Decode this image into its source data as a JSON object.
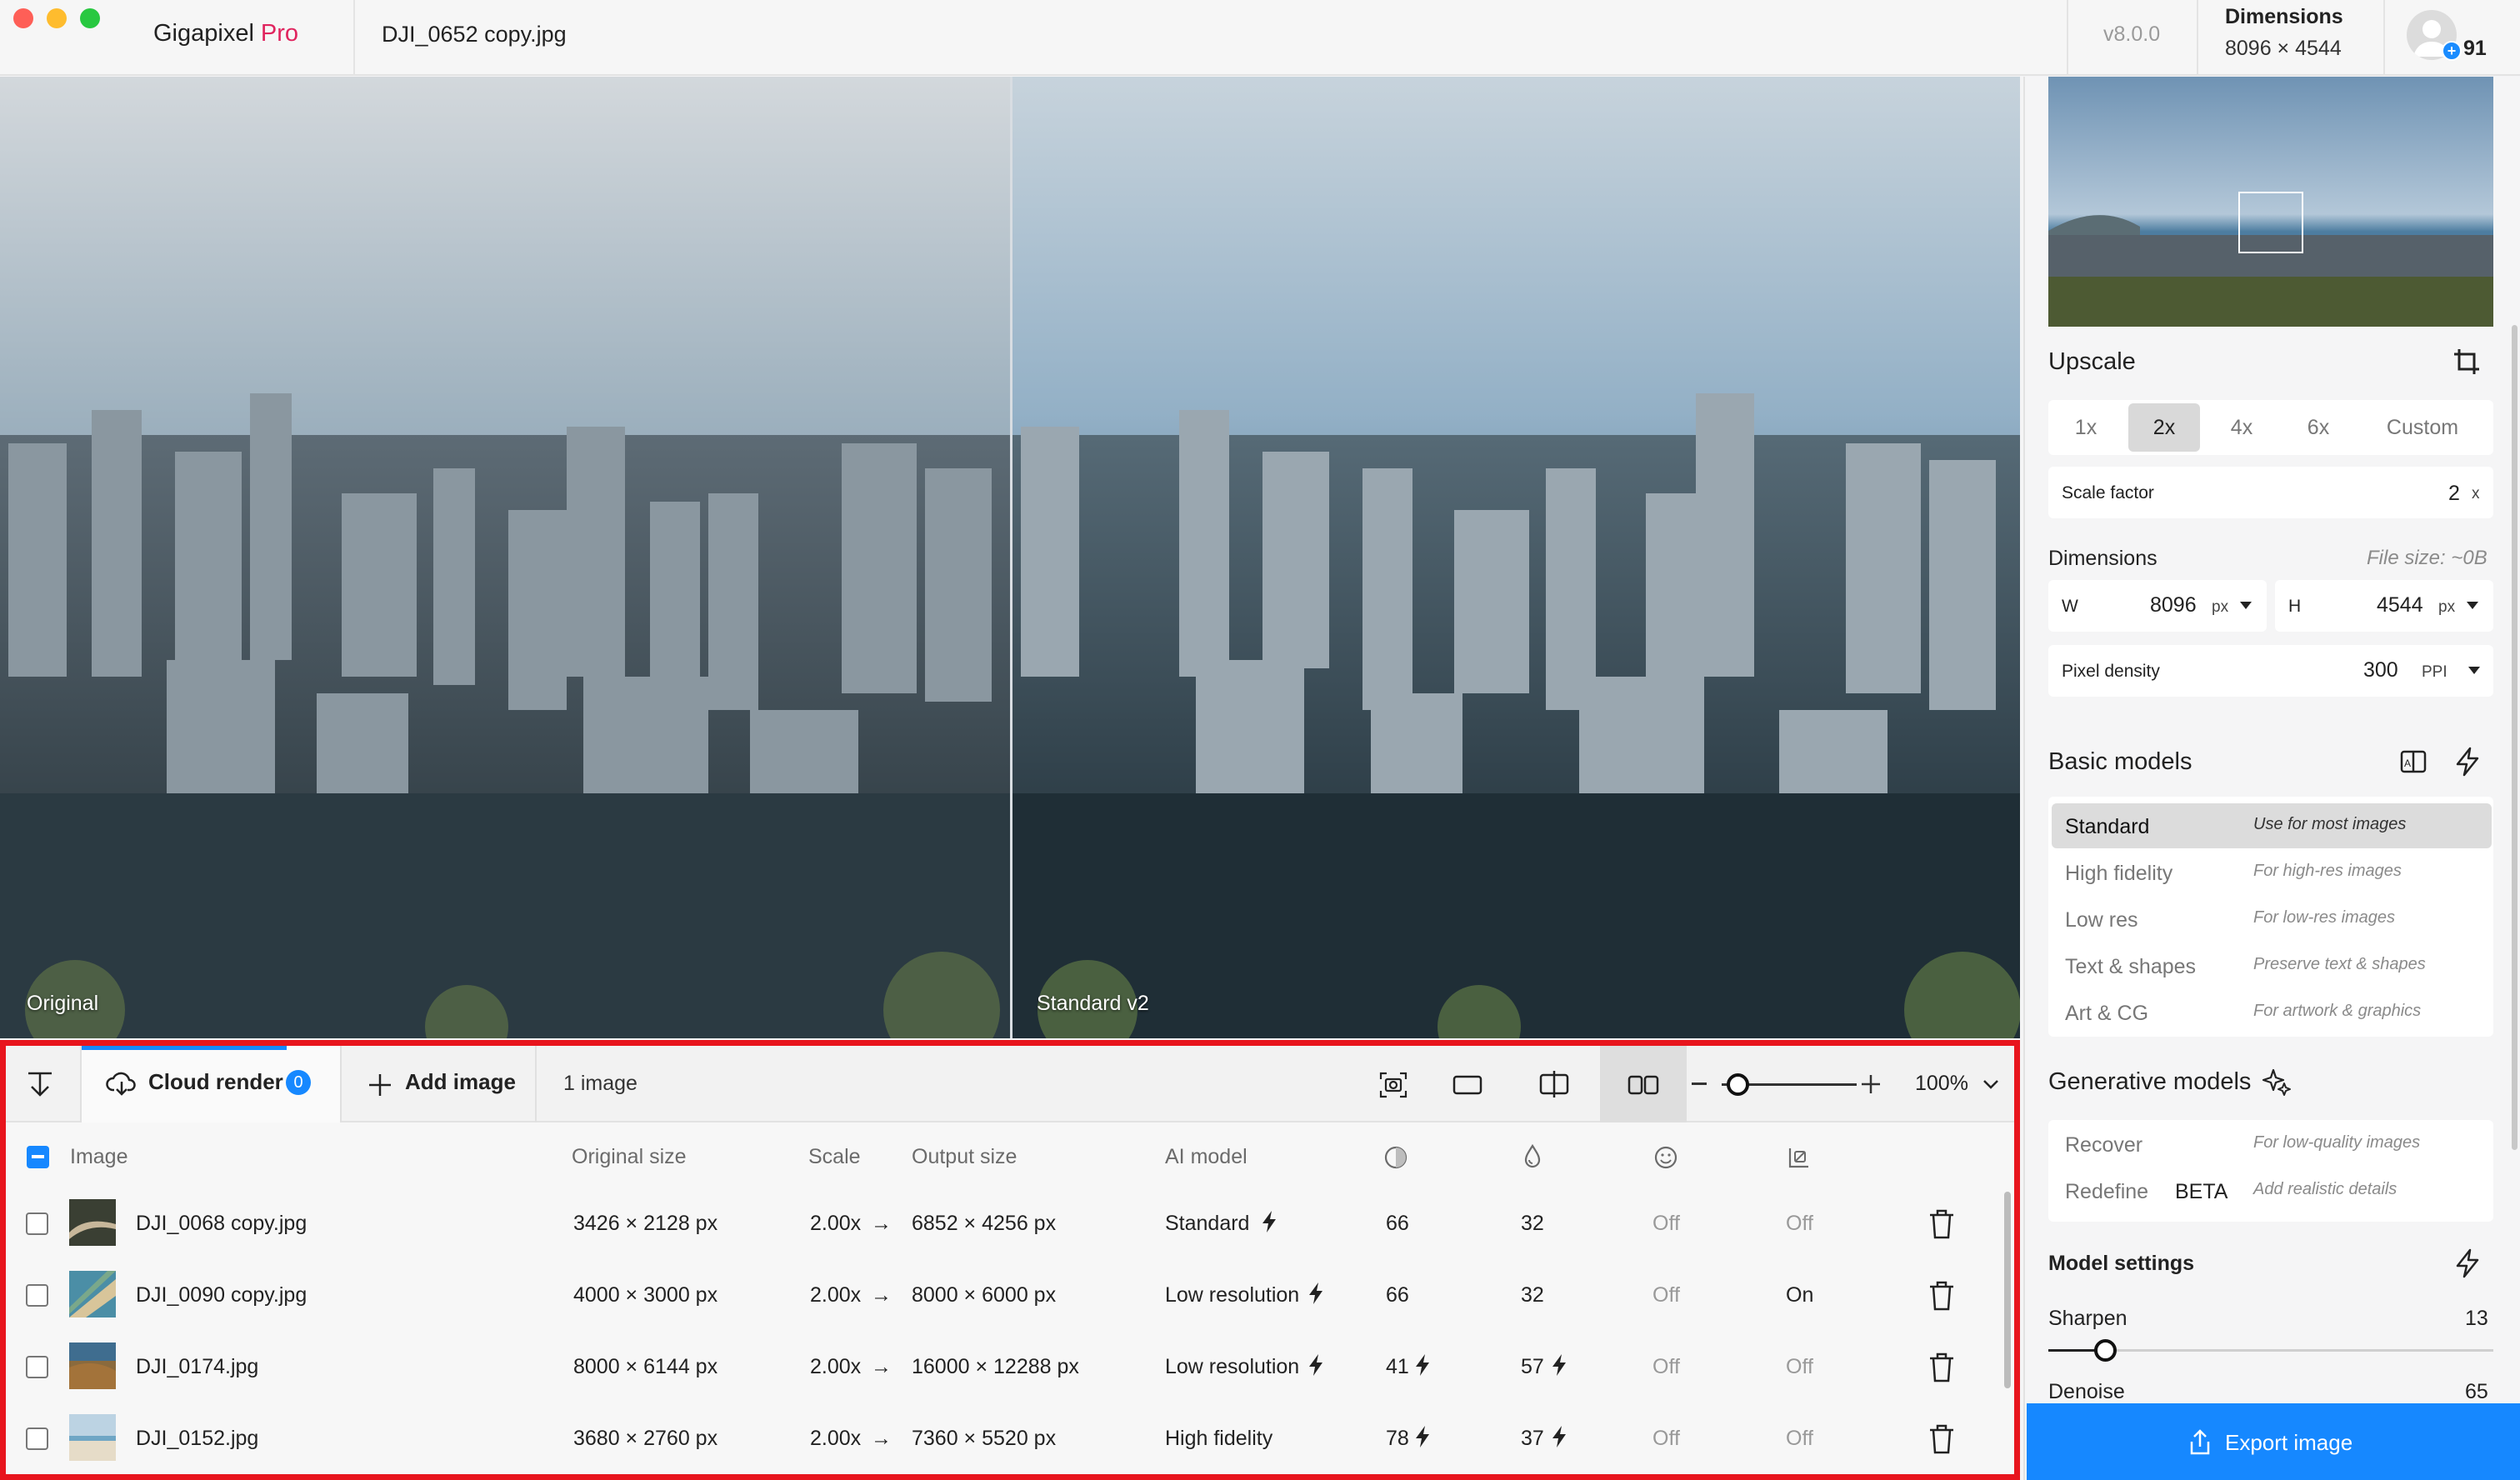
{
  "app": {
    "name": "Gigapixel",
    "badge": "Pro",
    "file_name": "DJI_0652 copy.jpg",
    "version": "v8.0.0",
    "dimensions_label": "Dimensions",
    "dimensions_value": "8096 × 4544",
    "credits": "91"
  },
  "preview": {
    "left_label": "Original",
    "right_label": "Standard v2"
  },
  "upscale": {
    "title": "Upscale",
    "scales": [
      "1x",
      "2x",
      "4x",
      "6x",
      "Custom"
    ],
    "active_scale": "2x",
    "scale_factor_label": "Scale factor",
    "scale_factor_value": "2",
    "scale_factor_unit": "x",
    "dimensions_label": "Dimensions",
    "file_size": "File size: ~0B",
    "width_label": "W",
    "width_value": "8096",
    "width_unit": "px",
    "height_label": "H",
    "height_value": "4544",
    "height_unit": "px",
    "density_label": "Pixel density",
    "density_value": "300",
    "density_unit": "PPI"
  },
  "basic_models": {
    "title": "Basic models",
    "items": [
      {
        "name": "Standard",
        "desc": "Use for most images"
      },
      {
        "name": "High fidelity",
        "desc": "For high-res images"
      },
      {
        "name": "Low res",
        "desc": "For low-res images"
      },
      {
        "name": "Text & shapes",
        "desc": "Preserve text & shapes"
      },
      {
        "name": "Art & CG",
        "desc": "For artwork & graphics"
      }
    ]
  },
  "generative_models": {
    "title": "Generative models",
    "items": [
      {
        "name": "Recover",
        "desc": "For low-quality images"
      },
      {
        "name": "Redefine",
        "tag": "BETA",
        "desc": "Add realistic details"
      }
    ]
  },
  "model_settings": {
    "title": "Model settings",
    "sharpen_label": "Sharpen",
    "sharpen_value": "13",
    "sharpen_level": 13,
    "denoise_label": "Denoise",
    "denoise_value": "65"
  },
  "export_label": "Export image",
  "queue": {
    "cloud_render_label": "Cloud render",
    "cloud_render_count": "0",
    "add_image_label": "Add image",
    "image_count": "1 image",
    "zoom": "100%",
    "zoom_level": 0.12,
    "columns": [
      "Image",
      "Original size",
      "Scale",
      "Output size",
      "AI model"
    ],
    "rows": [
      {
        "name": "DJI_0068 copy.jpg",
        "original": "3426 × 2128 px",
        "scale": "2.00x",
        "output": "6852 × 4256 px",
        "model": "Standard",
        "c1": "66",
        "c2": "32",
        "c3": "Off",
        "c4": "Off"
      },
      {
        "name": "DJI_0090 copy.jpg",
        "original": "4000 × 3000 px",
        "scale": "2.00x",
        "output": "8000 × 6000 px",
        "model": "Low resolution",
        "c1": "66",
        "c2": "32",
        "c3": "Off",
        "c4": "On"
      },
      {
        "name": "DJI_0174.jpg",
        "original": "8000 × 6144 px",
        "scale": "2.00x",
        "output": "16000 × 12288 px",
        "model": "Low resolution",
        "c1": "41",
        "c2": "57",
        "c3": "Off",
        "c4": "Off"
      },
      {
        "name": "DJI_0152.jpg",
        "original": "3680 × 2760 px",
        "scale": "2.00x",
        "output": "7360 × 5520 px",
        "model": "High fidelity",
        "c1": "78",
        "c2": "37",
        "c3": "Off",
        "c4": "Off"
      }
    ]
  }
}
